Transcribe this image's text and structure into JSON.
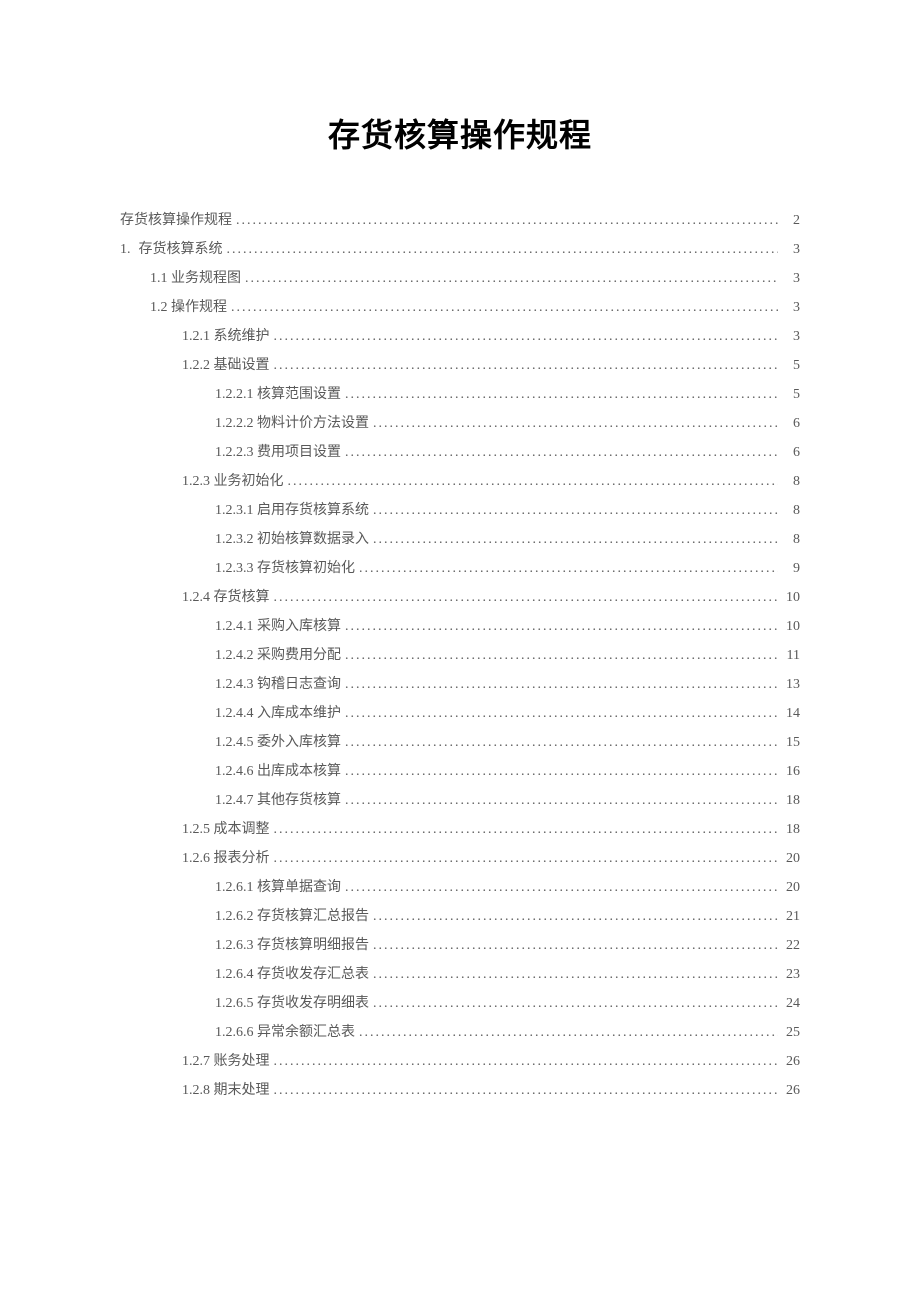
{
  "title": "存货核算操作规程",
  "toc": [
    {
      "indent": 0,
      "prefix": "",
      "label": "存货核算操作规程",
      "page": "2"
    },
    {
      "indent": 0,
      "prefix": "1.",
      "label": "存货核算系统",
      "page": "3"
    },
    {
      "indent": 1,
      "prefix": "",
      "label": "1.1 业务规程图",
      "page": "3"
    },
    {
      "indent": 1,
      "prefix": "",
      "label": "1.2 操作规程",
      "page": "3"
    },
    {
      "indent": 2,
      "prefix": "",
      "label": "1.2.1  系统维护",
      "page": "3"
    },
    {
      "indent": 2,
      "prefix": "",
      "label": "1.2.2 基础设置",
      "page": "5"
    },
    {
      "indent": 3,
      "prefix": "",
      "label": "1.2.2.1 核算范围设置",
      "page": "5"
    },
    {
      "indent": 3,
      "prefix": "",
      "label": "1.2.2.2 物料计价方法设置",
      "page": "6"
    },
    {
      "indent": 3,
      "prefix": "",
      "label": "1.2.2.3 费用项目设置",
      "page": "6"
    },
    {
      "indent": 2,
      "prefix": "",
      "label": "1.2.3 业务初始化",
      "page": "8"
    },
    {
      "indent": 3,
      "prefix": "",
      "label": "1.2.3.1 启用存货核算系统",
      "page": "8"
    },
    {
      "indent": 3,
      "prefix": "",
      "label": "1.2.3.2 初始核算数据录入",
      "page": "8"
    },
    {
      "indent": 3,
      "prefix": "",
      "label": "1.2.3.3 存货核算初始化",
      "page": "9"
    },
    {
      "indent": 2,
      "prefix": "",
      "label": "1.2.4 存货核算",
      "page": "10"
    },
    {
      "indent": 3,
      "prefix": "",
      "label": "1.2.4.1 采购入库核算",
      "page": "10"
    },
    {
      "indent": 3,
      "prefix": "",
      "label": "1.2.4.2 采购费用分配",
      "page": "11"
    },
    {
      "indent": 3,
      "prefix": "",
      "label": "1.2.4.3 钩稽日志查询",
      "page": "13"
    },
    {
      "indent": 3,
      "prefix": "",
      "label": "1.2.4.4 入库成本维护",
      "page": "14"
    },
    {
      "indent": 3,
      "prefix": "",
      "label": "1.2.4.5 委外入库核算",
      "page": "15"
    },
    {
      "indent": 3,
      "prefix": "",
      "label": "1.2.4.6 出库成本核算",
      "page": "16"
    },
    {
      "indent": 3,
      "prefix": "",
      "label": "1.2.4.7 其他存货核算",
      "page": "18"
    },
    {
      "indent": 2,
      "prefix": "",
      "label": "1.2.5 成本调整",
      "page": "18"
    },
    {
      "indent": 2,
      "prefix": "",
      "label": "1.2.6 报表分析",
      "page": "20"
    },
    {
      "indent": 3,
      "prefix": "",
      "label": "1.2.6.1 核算单据查询",
      "page": "20"
    },
    {
      "indent": 3,
      "prefix": "",
      "label": "1.2.6.2 存货核算汇总报告",
      "page": "21"
    },
    {
      "indent": 3,
      "prefix": "",
      "label": "1.2.6.3 存货核算明细报告",
      "page": "22"
    },
    {
      "indent": 3,
      "prefix": "",
      "label": "1.2.6.4 存货收发存汇总表",
      "page": "23"
    },
    {
      "indent": 3,
      "prefix": "",
      "label": "1.2.6.5 存货收发存明细表",
      "page": "24"
    },
    {
      "indent": 3,
      "prefix": "",
      "label": "1.2.6.6 异常余额汇总表",
      "page": "25"
    },
    {
      "indent": 2,
      "prefix": "",
      "label": "1.2.7 账务处理",
      "page": "26"
    },
    {
      "indent": 2,
      "prefix": "",
      "label": "1.2.8 期末处理",
      "page": "26"
    }
  ]
}
